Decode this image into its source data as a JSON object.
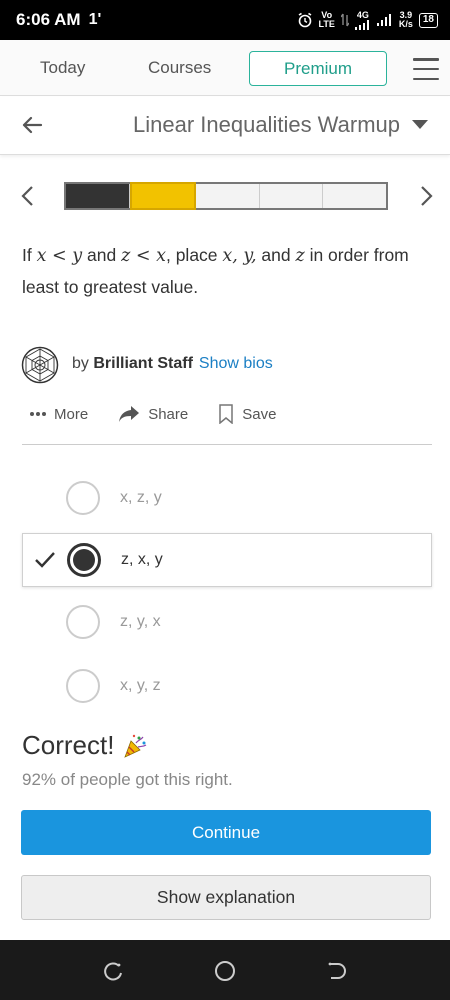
{
  "status_bar": {
    "time": "6:06 AM",
    "extra_glyph": "1'",
    "network_top": "Vo",
    "network_bottom": "LTE",
    "net_gen": "4G",
    "speed_top": "3.9",
    "speed_bottom": "K/s",
    "battery": "18"
  },
  "top_nav": {
    "today": "Today",
    "courses": "Courses",
    "premium": "Premium"
  },
  "title_bar": {
    "title": "Linear Inequalities Warmup"
  },
  "progress": {
    "segments": 5,
    "completed": 1,
    "current_index": 1,
    "done_color": "#333333",
    "current_color": "#f2c200"
  },
  "question": {
    "p1": "If ",
    "m1": "x < y",
    "p2": " and ",
    "m2": "z < x",
    "p3": ", place ",
    "m3": "x, y,",
    "p4": " and ",
    "m4": "z",
    "p5": " in order from least to greatest value."
  },
  "author": {
    "by": "by ",
    "name": "Brilliant Staff",
    "show_bios": "Show bios"
  },
  "actions": {
    "more": "More",
    "share": "Share",
    "save": "Save"
  },
  "options": [
    {
      "label": "x, z, y",
      "selected": false
    },
    {
      "label": "z, x, y",
      "selected": true
    },
    {
      "label": "z, y, x",
      "selected": false
    },
    {
      "label": "x, y, z",
      "selected": false
    }
  ],
  "feedback": {
    "title": "Correct!",
    "stat": "92% of people got this right."
  },
  "buttons": {
    "continue": "Continue",
    "show_explanation": "Show explanation",
    "continue_color": "#1a95de"
  },
  "icons": {
    "back": "arrow-left-icon",
    "caret": "caret-down-icon",
    "prev": "chevron-left-icon",
    "next": "chevron-right-icon",
    "menu": "hamburger-menu-icon",
    "share": "share-arrow-icon",
    "save": "bookmark-icon",
    "check": "checkmark-icon",
    "party": "party-popper-icon"
  }
}
